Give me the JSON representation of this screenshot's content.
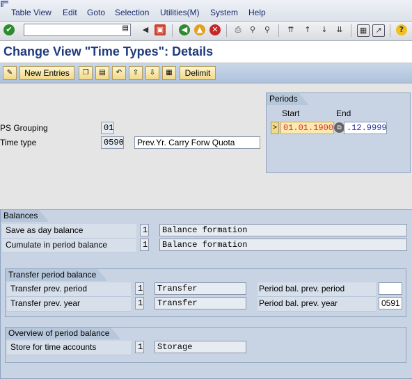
{
  "menubar": {
    "items": [
      "Table View",
      "Edit",
      "Goto",
      "Selection",
      "Utilities(M)",
      "System",
      "Help"
    ]
  },
  "toolbar": {
    "icons": [
      "enter-icon",
      "command-field-dropdown-icon",
      "back-arrow-icon",
      "save-icon",
      "back-icon",
      "exit-icon",
      "cancel-icon",
      "print-icon",
      "find-icon",
      "find-next-icon",
      "first-page-icon",
      "previous-page-icon",
      "next-page-icon",
      "last-page-icon",
      "create-session-icon",
      "shortcut-icon",
      "help-icon"
    ],
    "command_value": ""
  },
  "title": "Change View \"Time Types\": Details",
  "app_toolbar": {
    "new_entries": "New Entries",
    "delimit": "Delimit",
    "icons": [
      "display-change-icon",
      "copy-icon",
      "delete-icon",
      "undo-icon",
      "previous-entry-icon",
      "next-entry-icon",
      "other-entry-icon"
    ]
  },
  "header": {
    "ps_grouping_label": "PS Grouping",
    "ps_grouping_value": "01",
    "time_type_label": "Time type",
    "time_type_value": "0590",
    "time_type_text": "Prev.Yr. Carry Forw Quota"
  },
  "periods": {
    "title": "Periods",
    "start_label": "Start",
    "end_label": "End",
    "start_value": "01.01.1900",
    "end_value": ".12.9999",
    "marker": ">"
  },
  "balances": {
    "title": "Balances",
    "rows": [
      {
        "label": "Save as day balance",
        "code": "1",
        "text": "Balance formation"
      },
      {
        "label": "Cumulate in period balance",
        "code": "1",
        "text": "Balance formation"
      }
    ]
  },
  "transfer": {
    "title": "Transfer period balance",
    "rows": [
      {
        "label": "Transfer prev. period",
        "code": "1",
        "text": "Transfer",
        "right_label": "Period bal. prev. period",
        "right_value": ""
      },
      {
        "label": "Transfer prev. year",
        "code": "1",
        "text": "Transfer",
        "right_label": "Period bal. prev. year",
        "right_value": "0591"
      }
    ]
  },
  "overview": {
    "title": "Overview of period balance",
    "rows": [
      {
        "label": "Store for time accounts",
        "code": "1",
        "text": "Storage"
      }
    ]
  }
}
